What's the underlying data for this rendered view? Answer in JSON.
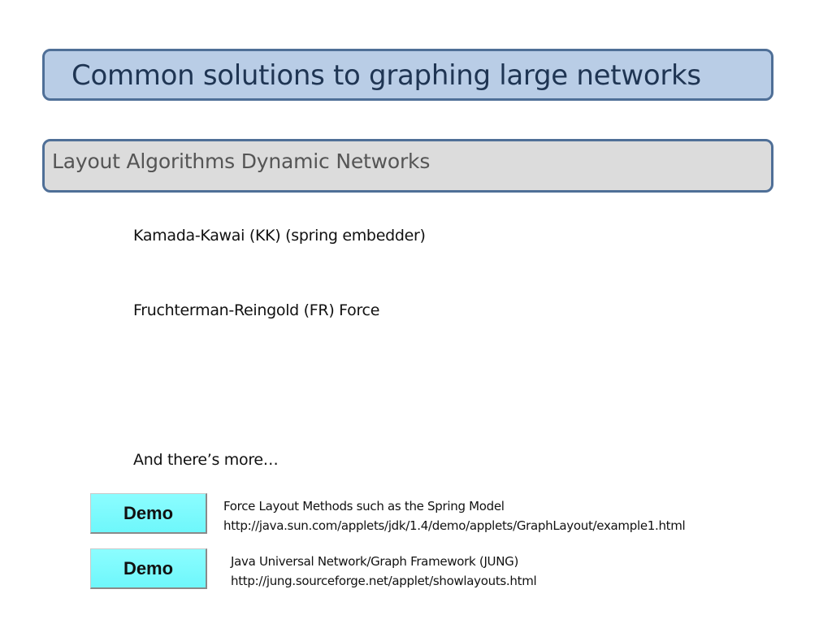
{
  "title": "Common solutions to graphing large networks",
  "subtitle": "Layout Algorithms Dynamic Networks",
  "bullets": [
    "Kamada-Kawai (KK) (spring embedder)",
    "Fruchterman-Reingold (FR) Force",
    "And there’s more…"
  ],
  "demos": [
    {
      "button_label": "Demo",
      "description": "Force Layout Methods such as the Spring Model",
      "url": "http://java.sun.com/applets/jdk/1.4/demo/applets/GraphLayout/example1.html"
    },
    {
      "button_label": "Demo",
      "description": "Java Universal Network/Graph Framework (JUNG)",
      "url": "http://jung.sourceforge.net/applet/showlayouts.html"
    }
  ],
  "colors": {
    "title_fill": "#b9cde6",
    "box_border": "#4f6f97",
    "subtitle_fill": "#dcdcdc",
    "demo_button_fill": "#7cfcff"
  }
}
